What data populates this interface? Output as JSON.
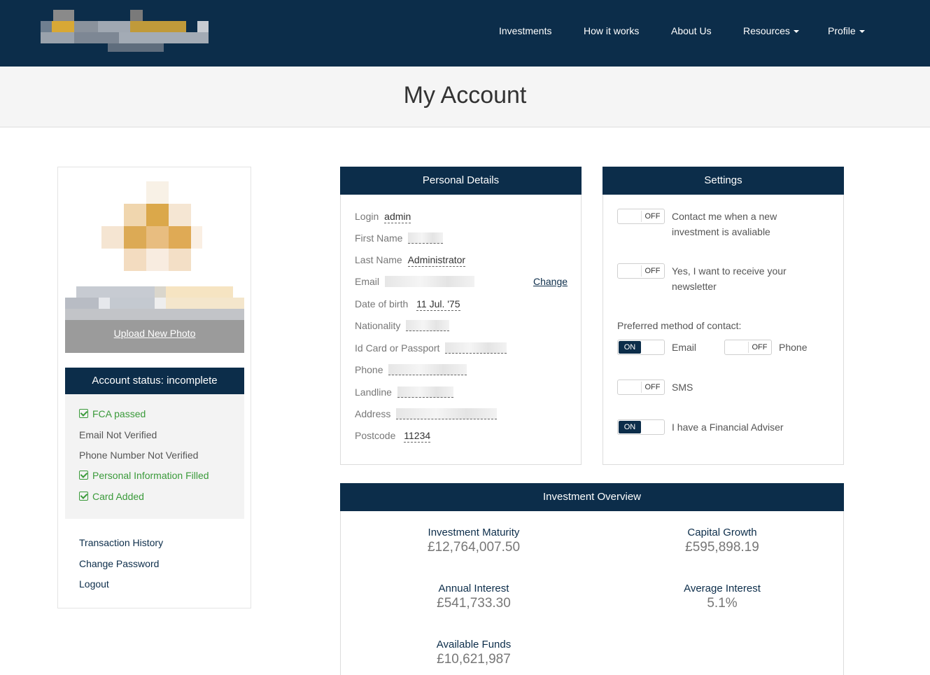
{
  "nav": {
    "items": [
      {
        "label": "Investments"
      },
      {
        "label": "How it works"
      },
      {
        "label": "About Us"
      },
      {
        "label": "Resources"
      },
      {
        "label": "Profile"
      }
    ]
  },
  "page": {
    "title": "My Account"
  },
  "profile": {
    "upload_label": "Upload New Photo",
    "status_title": "Account status: incomplete",
    "status_items": [
      {
        "label": "FCA passed"
      },
      {
        "label": "Email Not Verified"
      },
      {
        "label": "Phone Number Not Verified"
      },
      {
        "label": "Personal Information Filled"
      },
      {
        "label": "Card Added"
      }
    ],
    "links": [
      {
        "label": "Transaction History"
      },
      {
        "label": "Change Password"
      },
      {
        "label": "Logout"
      }
    ]
  },
  "personal": {
    "title": "Personal Details",
    "change_label": "Change",
    "fields": {
      "login": {
        "label": "Login",
        "value": "admin"
      },
      "first_name": {
        "label": "First Name"
      },
      "last_name": {
        "label": "Last Name",
        "value": "Administrator"
      },
      "email": {
        "label": "Email"
      },
      "dob": {
        "label": "Date of birth",
        "value": "11 Jul. '75"
      },
      "nationality": {
        "label": "Nationality"
      },
      "id_card": {
        "label": "Id Card or Passport"
      },
      "phone": {
        "label": "Phone"
      },
      "landline": {
        "label": "Landline"
      },
      "address": {
        "label": "Address"
      },
      "postcode": {
        "label": "Postcode",
        "value": "11234"
      }
    }
  },
  "settings": {
    "title": "Settings",
    "on_label": "ON",
    "off_label": "OFF",
    "contact_new": "Contact me when a new investment is avaliable",
    "newsletter": "Yes, I want to receive your newsletter",
    "preferred_label": "Preferred method of contact:",
    "email_label": "Email",
    "phone_label": "Phone",
    "sms_label": "SMS",
    "adviser_label": "I have a Financial Adviser"
  },
  "overview": {
    "title": "Investment Overview",
    "investment_maturity": {
      "label": "Investment Maturity",
      "value": "£12,764,007.50"
    },
    "capital_growth": {
      "label": "Capital Growth",
      "value": "£595,898.19"
    },
    "annual_interest": {
      "label": "Annual Interest",
      "value": "£541,733.30"
    },
    "average_interest": {
      "label": "Average Interest",
      "value": "5.1%"
    },
    "available_funds": {
      "label": "Available Funds",
      "value": "£10,621,987"
    }
  },
  "colors": {
    "brand": "#0c2d4a",
    "success": "#3a9a3a"
  }
}
